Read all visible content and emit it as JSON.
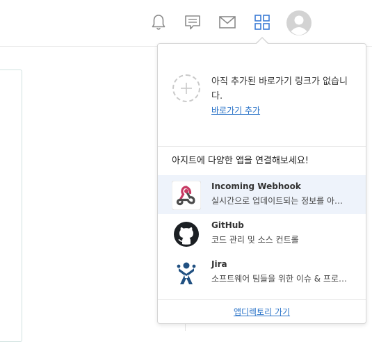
{
  "topbar": {
    "icons": [
      {
        "name": "bell-icon"
      },
      {
        "name": "chat-icon"
      },
      {
        "name": "mail-icon"
      },
      {
        "name": "apps-grid-icon"
      },
      {
        "name": "avatar-icon"
      }
    ]
  },
  "dropdown": {
    "empty_message": "아직 추가된 바로가기 링크가 없습니다.",
    "add_shortcut_label": "바로가기 추가",
    "apps_title": "아지트에 다양한 앱을 연결해보세요!",
    "apps": [
      {
        "name": "Incoming Webhook",
        "description": "실시간으로 업데이트되는 정보를 아지트에서 받아보세요"
      },
      {
        "name": "GitHub",
        "description": "코드 관리 및 소스 컨트롤"
      },
      {
        "name": "Jira",
        "description": "소프트웨어 팀들을 위한 이슈 & 프로젝트 관리"
      }
    ],
    "app_directory_label": "앱디렉토리 가기"
  },
  "colors": {
    "accent": "#2a73c8",
    "highlight_row": "#eef3fb"
  }
}
